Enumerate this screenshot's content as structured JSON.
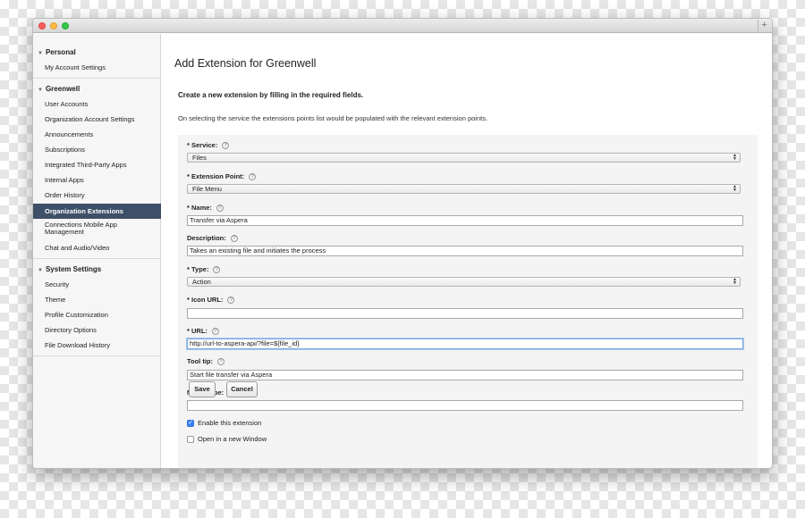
{
  "window": {
    "new_tab_label": "+"
  },
  "sidebar": {
    "personal": {
      "heading": "Personal",
      "items": [
        "My Account Settings"
      ]
    },
    "org": {
      "heading": "Greenwell",
      "items": [
        "User Accounts",
        "Organization Account Settings",
        "Announcements",
        "Subscriptions",
        "Integrated Third-Party Apps",
        "Internal Apps",
        "Order History",
        "Organization Extensions",
        "Connections Mobile App Management",
        "Chat and Audio/Video"
      ]
    },
    "system": {
      "heading": "System Settings",
      "items": [
        "Security",
        "Theme",
        "Profile Customization",
        "Directory Options",
        "File Download History"
      ]
    }
  },
  "main": {
    "title": "Add Extension for Greenwell",
    "heading": "Create a new extension by filling in the required fields.",
    "info": "On selecting the service the extensions points list would be populated with the relevant extension points."
  },
  "form": {
    "help_glyph": "?",
    "service": {
      "label": "* Service:",
      "value": "Files"
    },
    "extension_point": {
      "label": "* Extension Point:",
      "value": "File Menu"
    },
    "name": {
      "label": "* Name:",
      "value": "Transfer via Aspera"
    },
    "description": {
      "label": "Description:",
      "value": "Takes an existing file and initiates the process"
    },
    "type": {
      "label": "* Type:",
      "value": "Action"
    },
    "icon_url": {
      "label": "*  Icon URL:",
      "value": ""
    },
    "url": {
      "label": "* URL:",
      "value": "http://url-to-aspera-api/?file=${file_id}"
    },
    "tooltip": {
      "label": "Tool tip:",
      "value": "Start file transfer via Aspera"
    },
    "mime": {
      "label": "MIME Type:",
      "value": ""
    },
    "enable": {
      "label": "Enable this extension",
      "checked": true
    },
    "new_window": {
      "label": "Open in a new Window",
      "checked": false
    },
    "save_label": "Save",
    "cancel_label": "Cancel"
  },
  "colors": {
    "active_item": "#3d5068",
    "checkbox": "#3b82f6"
  }
}
